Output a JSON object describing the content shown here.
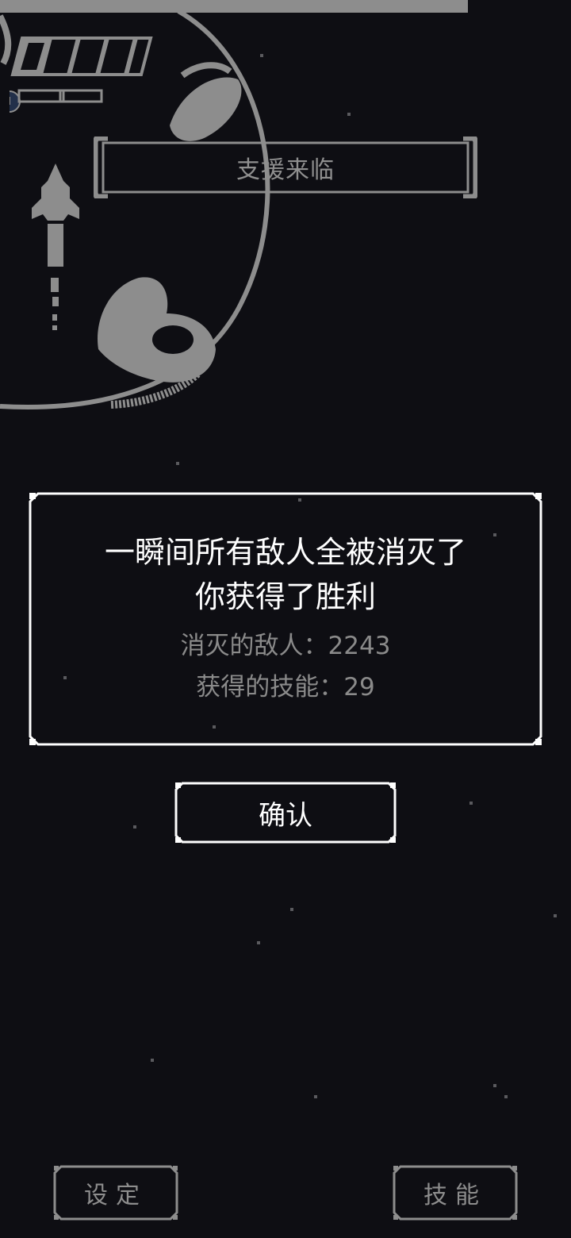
{
  "hud": {
    "health_fill_fraction": 0.82,
    "energy_cells": 5,
    "energy_filled": 1,
    "skill_meter_cells": 2
  },
  "banner": {
    "text": "支援来临"
  },
  "result": {
    "line1": "一瞬间所有敌人全被消灭了",
    "line2": "你获得了胜利",
    "enemies_label": "消灭的敌人：",
    "enemies_value": "2243",
    "skills_label": "获得的技能：",
    "skills_value": "29"
  },
  "confirm_button": {
    "label": "确认"
  },
  "bottom_bar": {
    "settings_label": "设定",
    "skills_label": "技能"
  },
  "colors": {
    "background": "#0e0e13",
    "ui_gray": "#8d8d8d",
    "text_white": "#ffffff",
    "stat_gray": "#8a8a8a"
  },
  "icons": [
    "ship-icon",
    "planet-icon",
    "energy-orb-icon"
  ]
}
